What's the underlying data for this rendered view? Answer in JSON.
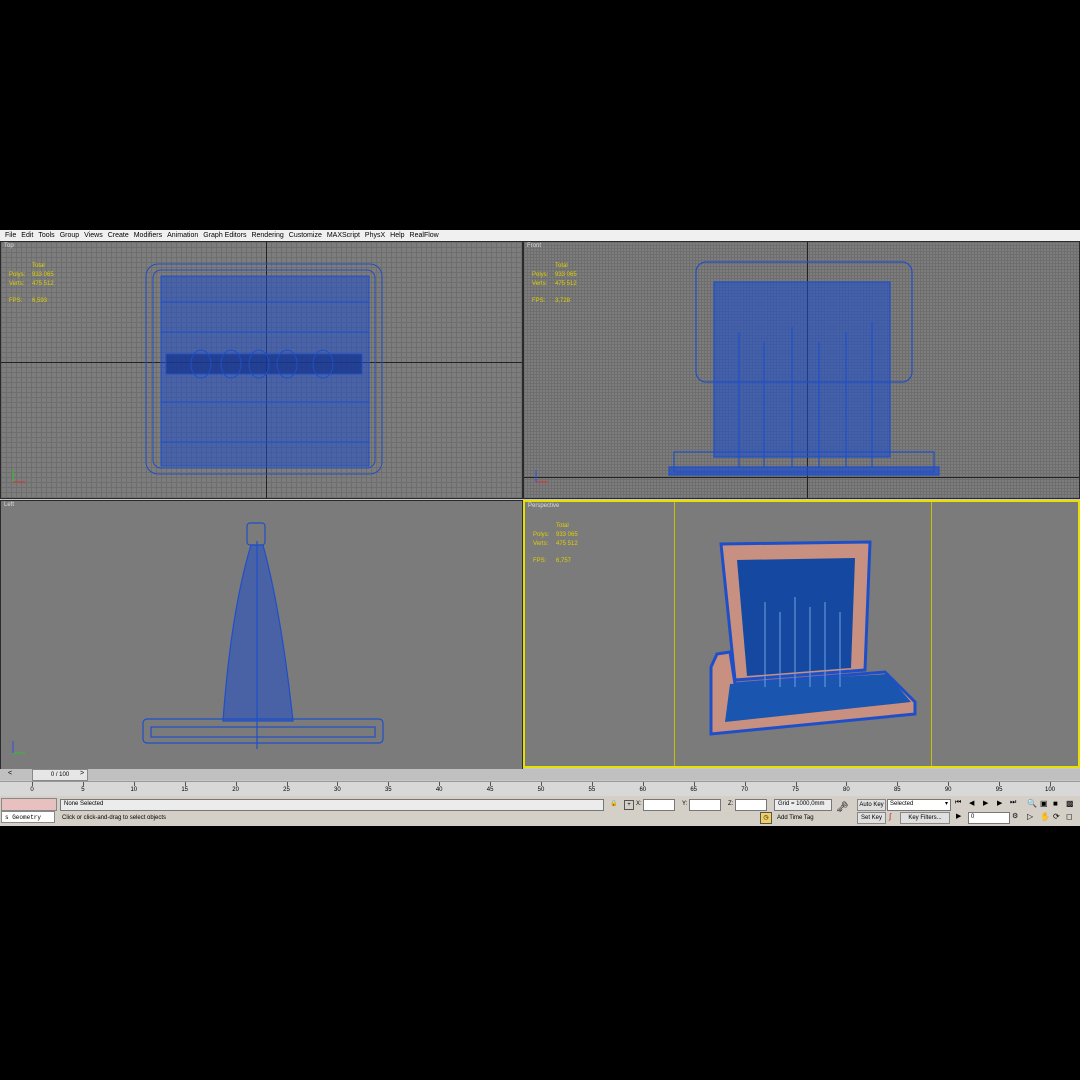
{
  "menu": [
    "File",
    "Edit",
    "Tools",
    "Group",
    "Views",
    "Create",
    "Modifiers",
    "Animation",
    "Graph Editors",
    "Rendering",
    "Customize",
    "MAXScript",
    "PhysX",
    "Help",
    "RealFlow"
  ],
  "viewports": {
    "top": {
      "label": "Top",
      "stats": {
        "total": "Total",
        "polys_label": "Polys:",
        "polys": "933 065",
        "verts_label": "Verts:",
        "verts": "475 512",
        "fps_label": "FPS:",
        "fps": "6,593"
      }
    },
    "front": {
      "label": "Front",
      "stats": {
        "total": "Total",
        "polys_label": "Polys:",
        "polys": "933 065",
        "verts_label": "Verts:",
        "verts": "475 512",
        "fps_label": "FPS:",
        "fps": "3,728"
      }
    },
    "left": {
      "label": "Left"
    },
    "perspective": {
      "label": "Perspective",
      "stats": {
        "total": "Total",
        "polys_label": "Polys:",
        "polys": "933 065",
        "verts_label": "Verts:",
        "verts": "475 512",
        "fps_label": "FPS:",
        "fps": "6,757"
      }
    }
  },
  "timeline": {
    "slider": "0 / 100",
    "ticks": [
      "0",
      "5",
      "10",
      "15",
      "20",
      "25",
      "30",
      "35",
      "40",
      "45",
      "50",
      "55",
      "60",
      "65",
      "70",
      "75",
      "80",
      "85",
      "90",
      "95",
      "100"
    ]
  },
  "status": {
    "selection": "None Selected",
    "prompt": "Click or click-and-drag to select objects",
    "script_tab": "s Geometry",
    "x_label": "X:",
    "y_label": "Y:",
    "z_label": "Z:",
    "grid": "Grid = 1000,0mm",
    "add_time_tag": "Add Time Tag",
    "auto_key": "Auto Key",
    "set_key": "Set Key",
    "key_mode": "Selected",
    "key_filters": "Key Filters...",
    "frame": "0"
  },
  "colors": {
    "wire": "#1f4fc8",
    "stats": "#e0d000",
    "active_border": "#e8e000"
  }
}
